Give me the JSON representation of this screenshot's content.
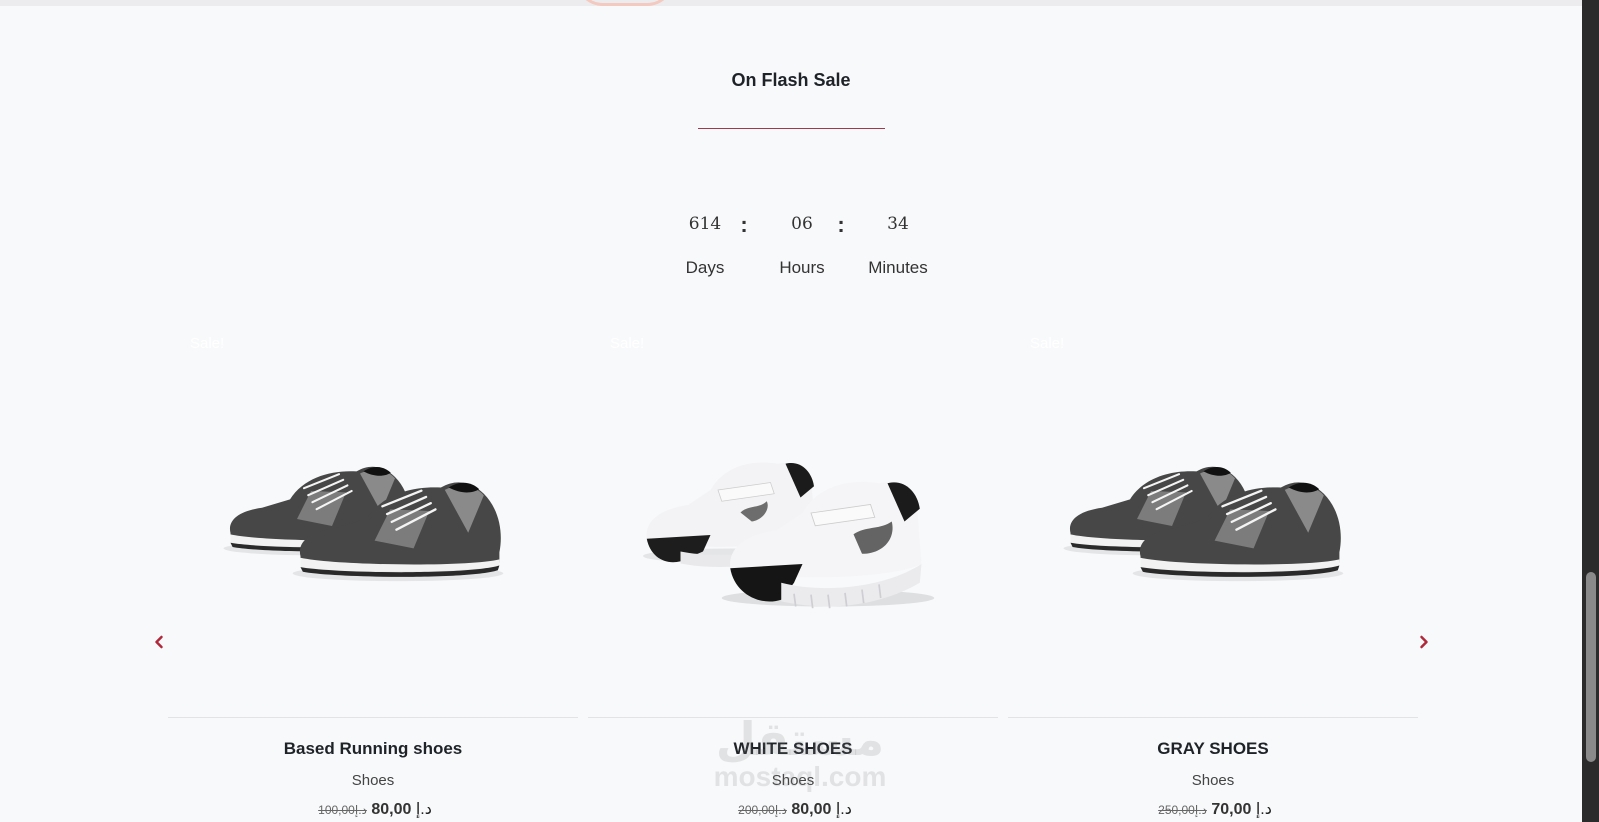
{
  "section": {
    "title": "On Flash Sale"
  },
  "countdown": {
    "days_value": "614",
    "hours_value": "06",
    "minutes_value": "34",
    "separator": ":",
    "days_label": "Days",
    "hours_label": "Hours",
    "minutes_label": "Minutes"
  },
  "products": [
    {
      "badge": "Sale!",
      "name": "Based Running shoes",
      "category": "Shoes",
      "price": "80,00",
      "old_price": "100,00",
      "currency": "د.إ",
      "image": "gray-running-shoes"
    },
    {
      "badge": "Sale!",
      "name": "WHITE SHOES",
      "category": "Shoes",
      "price": "80,00",
      "old_price": "200,00",
      "currency": "د.إ",
      "image": "white-velcro-shoes"
    },
    {
      "badge": "Sale!",
      "name": "GRAY SHOES",
      "category": "Shoes",
      "price": "70,00",
      "old_price": "250,00",
      "currency": "د.إ",
      "image": "gray-running-shoes"
    }
  ],
  "navigation": {
    "prev_icon": "chevron-left-icon",
    "next_icon": "chevron-right-icon",
    "accent_color": "#b0283a"
  },
  "watermark": {
    "arabic": "مستقل",
    "latin": "mostaql.com"
  },
  "colors": {
    "background": "#f8f9fb",
    "underline": "#9e3a4e",
    "text": "#1f2328"
  }
}
